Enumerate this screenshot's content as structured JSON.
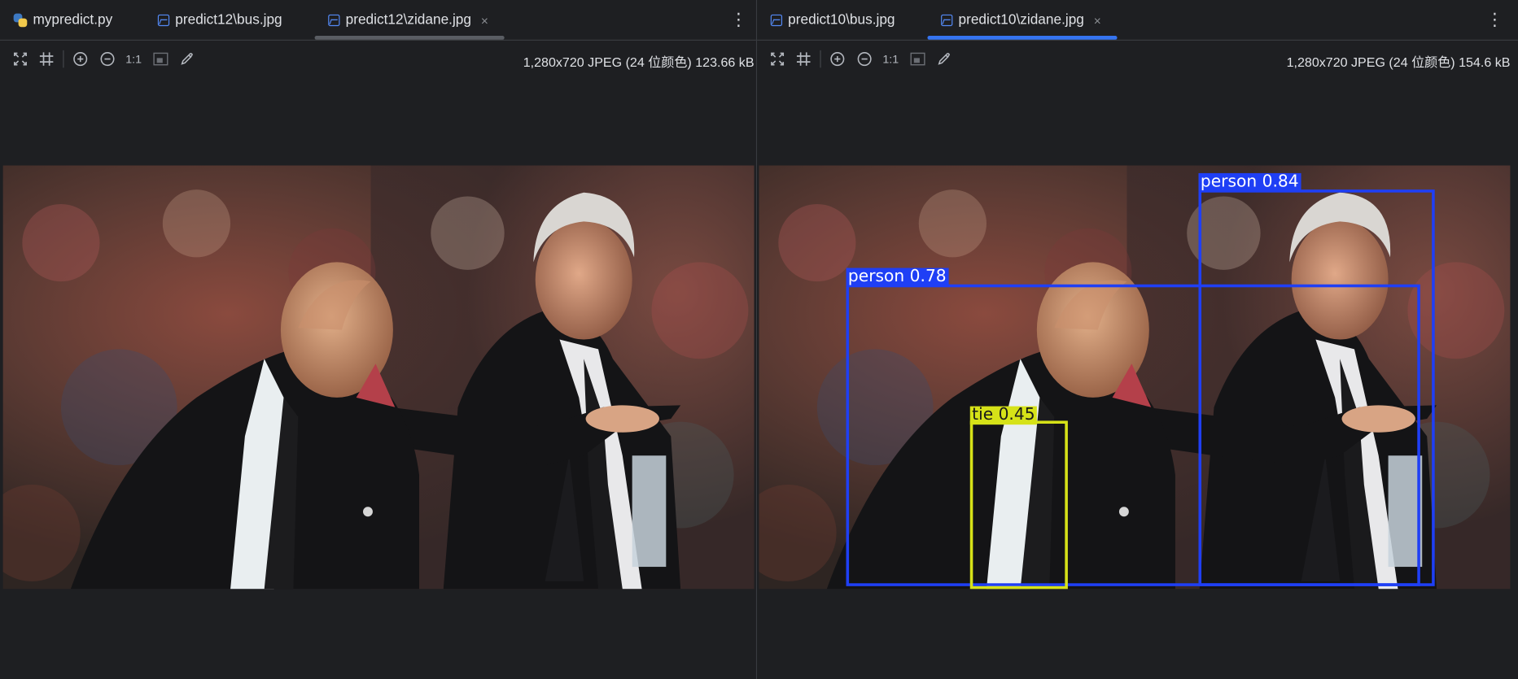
{
  "left_pane": {
    "tabs": [
      {
        "label": "mypredict.py",
        "icon": "python-file-icon"
      },
      {
        "label": "predict12\\bus.jpg",
        "icon": "image-file-icon"
      },
      {
        "label": "predict12\\zidane.jpg",
        "icon": "image-file-icon",
        "active": true,
        "close": "×"
      }
    ],
    "zoom_label": "1:1",
    "file_info": "1,280x720 JPEG (24 位颜色) 123.66 kB"
  },
  "right_pane": {
    "tabs": [
      {
        "label": "predict10\\bus.jpg",
        "icon": "image-file-icon"
      },
      {
        "label": "predict10\\zidane.jpg",
        "icon": "image-file-icon",
        "active": true,
        "close": "×"
      }
    ],
    "zoom_label": "1:1",
    "file_info": "1,280x720 JPEG (24 位颜色) 154.6 kB",
    "detections": [
      {
        "label": "person 0.84",
        "class": "person",
        "confidence": 0.84
      },
      {
        "label": "person 0.78",
        "class": "person",
        "confidence": 0.78
      },
      {
        "label": "tie 0.45",
        "class": "tie",
        "confidence": 0.45
      }
    ]
  },
  "colors": {
    "background": "#1e1f22",
    "active_tab_underline": "#3574f0",
    "inactive_tab_underline": "#5a5d63",
    "person_box": "#1f3ff5",
    "tie_box": "#d6e218"
  },
  "menu_icon": "⋮",
  "close_glyph": "×"
}
